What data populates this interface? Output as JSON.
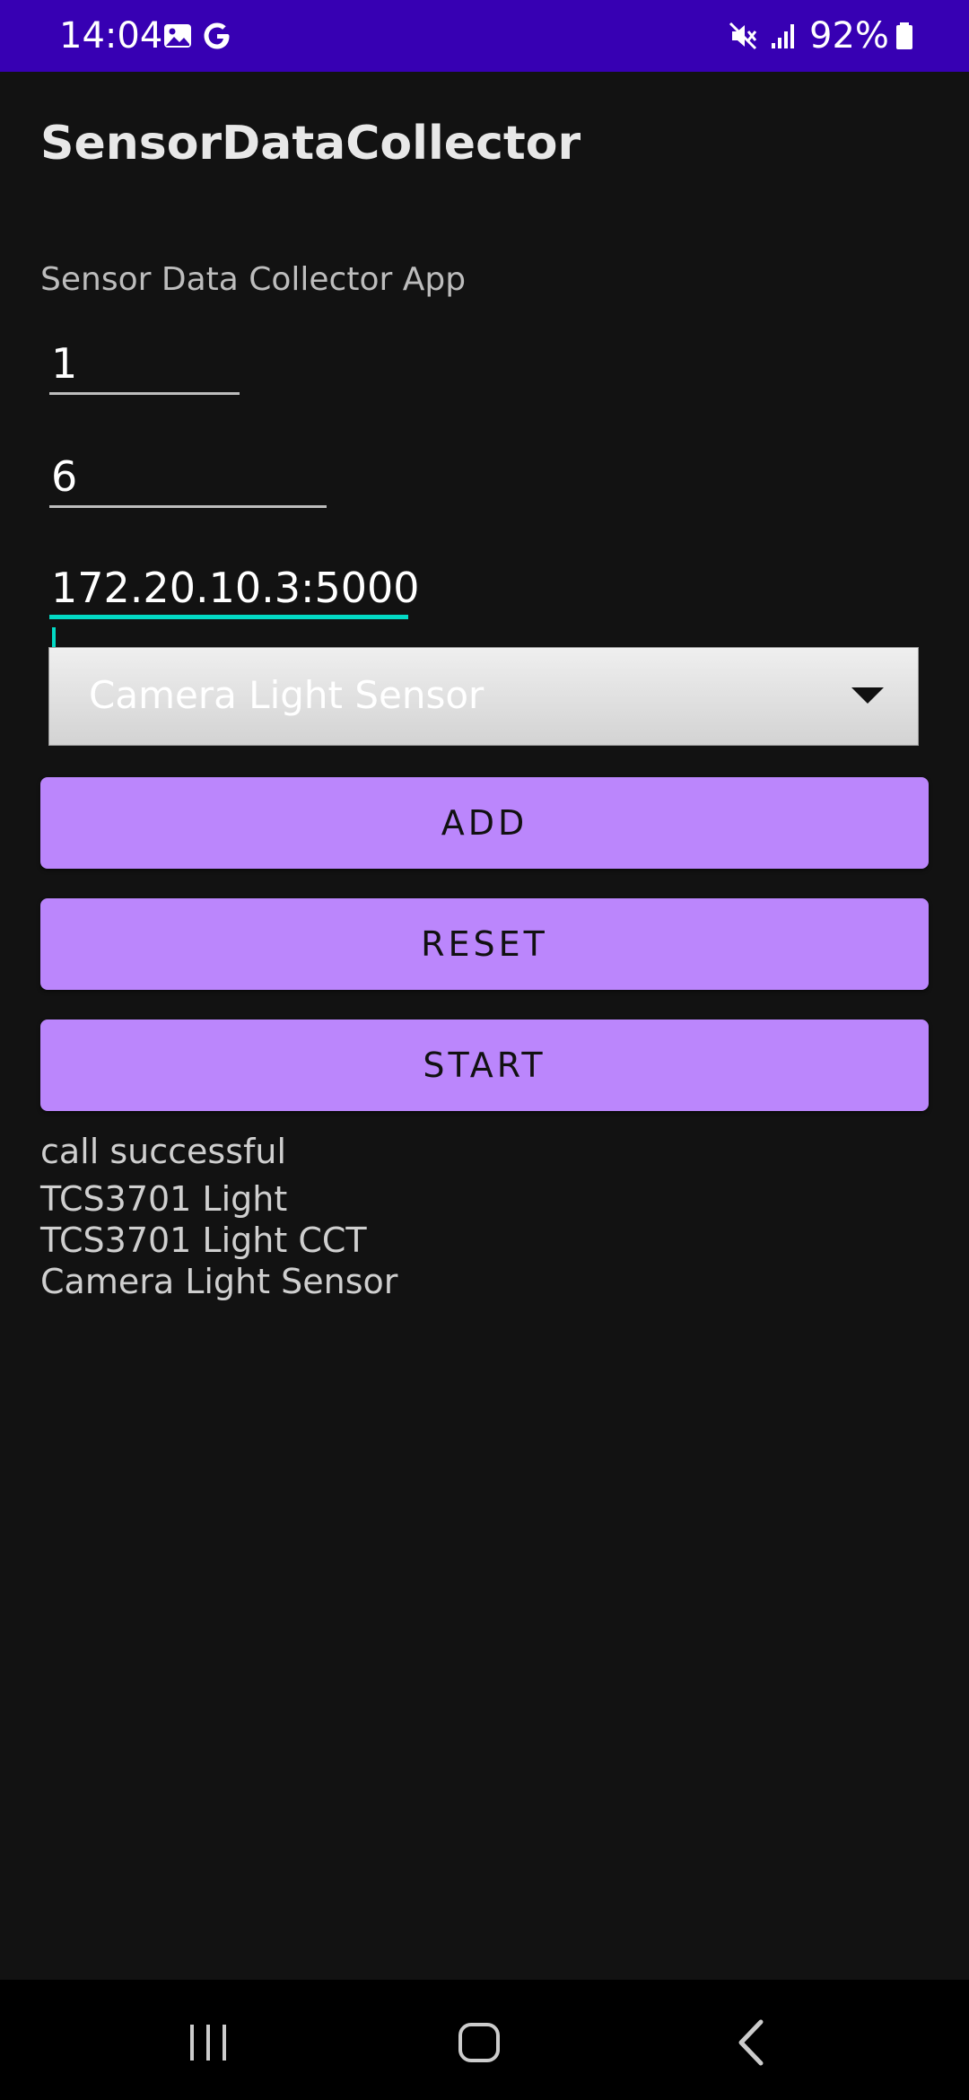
{
  "status_bar": {
    "time": "14:04",
    "battery": "92%",
    "icons": [
      "image-icon",
      "google-icon",
      "mute-icon",
      "signal-icon",
      "battery-icon"
    ],
    "background": "#3700B3"
  },
  "app": {
    "title": "SensorDataCollector",
    "subtitle": "Sensor Data Collector App"
  },
  "inputs": {
    "field1_value": "1",
    "field2_value": "6",
    "server_value": "172.20.10.3:5000"
  },
  "spinner": {
    "selected": "Camera Light Sensor"
  },
  "buttons": {
    "add": "ADD",
    "reset": "RESET",
    "start": "START",
    "color": "#BB86FC"
  },
  "log": {
    "status": "call successful",
    "items": [
      "TCS3701 Light",
      "TCS3701 Light CCT",
      "Camera Light Sensor"
    ]
  },
  "nav_bar": {
    "icons": [
      "recents-icon",
      "home-icon",
      "back-icon"
    ]
  }
}
